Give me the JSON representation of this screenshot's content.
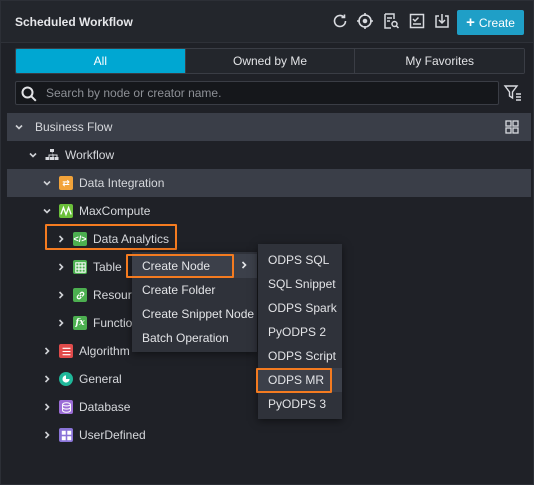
{
  "header": {
    "title": "Scheduled Workflow",
    "create_label": "Create",
    "tools": [
      "refresh-icon",
      "locate-icon",
      "search-code-icon",
      "checklist-icon",
      "import-icon"
    ]
  },
  "tabs": [
    {
      "label": "All",
      "active": true
    },
    {
      "label": "Owned by Me",
      "active": false
    },
    {
      "label": "My Favorites",
      "active": false
    }
  ],
  "search": {
    "placeholder": "Search by node or creator name.",
    "value": ""
  },
  "tree": {
    "business_flow": "Business Flow",
    "workflow": "Workflow",
    "data_integration": "Data Integration",
    "maxcompute": "MaxCompute",
    "data_analytics": "Data Analytics",
    "table": "Table",
    "resource": "Resourc",
    "function": "Function",
    "algorithm": "Algorithm",
    "general": "General",
    "database": "Database",
    "userdefined": "UserDefined"
  },
  "context_menu": {
    "items": [
      "Create Node",
      "Create Folder",
      "Create Snippet Node",
      "Batch Operation"
    ]
  },
  "submenu": {
    "items": [
      "ODPS SQL",
      "SQL Snippet",
      "ODPS Spark",
      "PyODPS 2",
      "ODPS Script",
      "ODPS MR",
      "PyODPS 3"
    ]
  },
  "colors": {
    "accent": "#00a7d2",
    "highlight_box": "#f47b20",
    "data_integration_icon": "#f2a33a",
    "maxcompute_icon": "#6bbf3a",
    "data_analytics_icon": "#4caf50",
    "algorithm_icon": "#e04b4b",
    "general_icon": "#1fb89a",
    "database_icon": "#9b6cd6",
    "userdefined_icon": "#8a74d8"
  }
}
